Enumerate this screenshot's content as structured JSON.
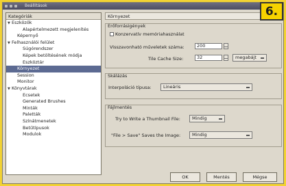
{
  "badge": "6.",
  "window": {
    "title": "Beállítások"
  },
  "sidebar": {
    "header": "Kategóriák",
    "items": [
      {
        "label": "Eszközök",
        "level": 0,
        "arrow": "▼"
      },
      {
        "label": "Alapértelmezett megjelenítés",
        "level": 2
      },
      {
        "label": "Képernyő",
        "level": 1
      },
      {
        "label": "Felhasználói felület",
        "level": 0,
        "arrow": "▼"
      },
      {
        "label": "Súgórendszer",
        "level": 2
      },
      {
        "label": "Képek betöltésének módja",
        "level": 2
      },
      {
        "label": "Eszköztár",
        "level": 2
      },
      {
        "label": "Környezet",
        "level": 1,
        "selected": true
      },
      {
        "label": "Session",
        "level": 1
      },
      {
        "label": "Monitor",
        "level": 1
      },
      {
        "label": "Könyvtárak",
        "level": 0,
        "arrow": "▼"
      },
      {
        "label": "Ecsetek",
        "level": 2
      },
      {
        "label": "Generated Brushes",
        "level": 2
      },
      {
        "label": "Minták",
        "level": 2
      },
      {
        "label": "Paletták",
        "level": 2
      },
      {
        "label": "Színátmenetek",
        "level": 2
      },
      {
        "label": "Betűtípusok",
        "level": 2
      },
      {
        "label": "Modulok",
        "level": 2
      }
    ]
  },
  "main": {
    "title": "Környezet",
    "resource_group": {
      "title": "Erőforrásigények",
      "conserve_memory_label": "Konzervatív memóriahasználat",
      "undo_levels_label": "Visszavonható műveletek száma:",
      "undo_levels_value": "200",
      "tile_cache_label": "Tile Cache Size:",
      "tile_cache_value": "32",
      "tile_cache_unit": "megabájt"
    },
    "scaling_group": {
      "title": "Skálázás",
      "interp_label": "Interpoláció típusa:",
      "interp_value": "Lineáris"
    },
    "file_group": {
      "title": "Fájlmentés",
      "thumbnail_label": "Try to Write a Thumbnail File:",
      "thumbnail_value": "Mindig",
      "save_label": "\"File > Save\" Saves the Image:",
      "save_value": "Mindig"
    }
  },
  "buttons": {
    "ok": "OK",
    "save": "Mentés",
    "cancel": "Mégse"
  }
}
